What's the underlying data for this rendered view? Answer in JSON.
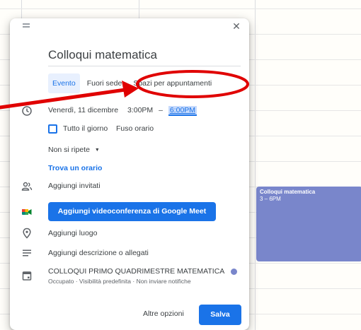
{
  "calendar_event": {
    "title": "Colloqui matematica",
    "time": "3 – 6PM",
    "color": "#7986cb"
  },
  "dialog": {
    "title": "Colloqui matematica",
    "tabs": [
      {
        "label": "Evento",
        "active": true
      },
      {
        "label": "Fuori sede",
        "active": false
      },
      {
        "label": "Spazi per appuntamenti",
        "active": false
      }
    ],
    "date": "Venerdì, 11 dicembre",
    "start_time": "3:00PM",
    "separator": "–",
    "end_time": "6:00PM",
    "all_day_label": "Tutto il giorno",
    "all_day_checked": false,
    "timezone_label": "Fuso orario",
    "recurrence": "Non si ripete",
    "find_time_link": "Trova un orario",
    "add_guests": "Aggiungi invitati",
    "meet_button": "Aggiungi videoconferenza di Google Meet",
    "add_location": "Aggiungi luogo",
    "add_description": "Aggiungi descrizione o allegati",
    "calendar_name": "COLLOQUI PRIMO QUADRIMESTRE MATEMATICA",
    "calendar_color": "#7986cb",
    "calendar_details": "Occupato · Visibilità predefinita · Non inviare notifiche",
    "more_options": "Altre opzioni",
    "save": "Salva"
  },
  "colors": {
    "accent": "#1a73e8",
    "annotation": "#e00000"
  }
}
